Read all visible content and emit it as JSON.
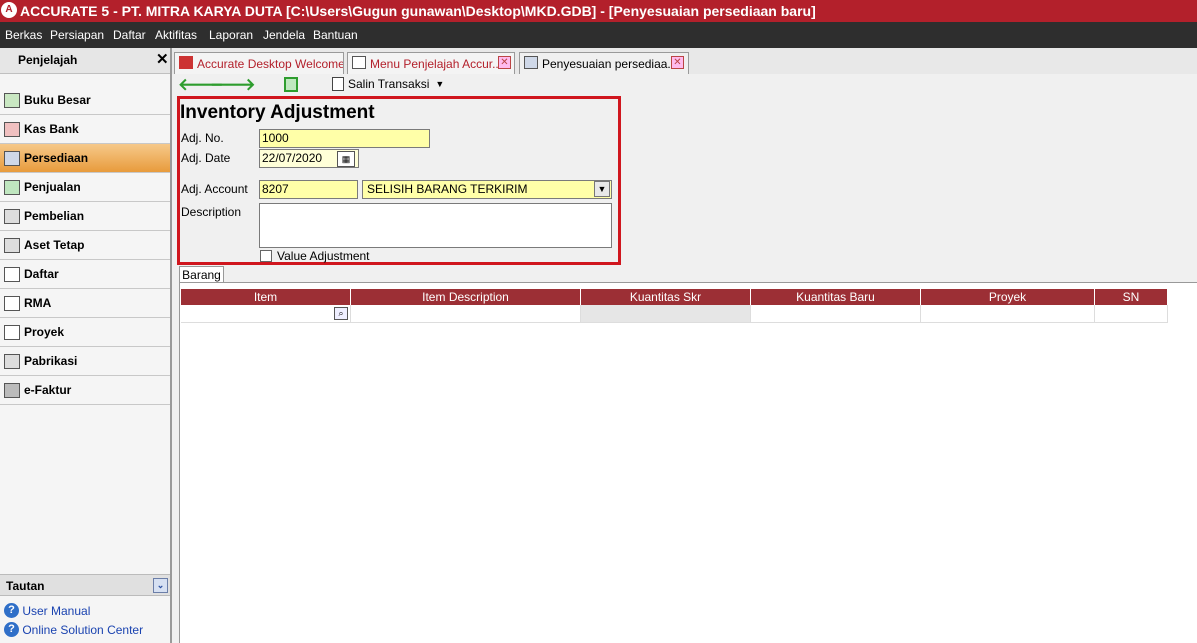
{
  "window": {
    "title": "ACCURATE 5  - PT. MITRA KARYA DUTA   [C:\\Users\\Gugun gunawan\\Desktop\\MKD.GDB] - [Penyesuaian persediaan baru]",
    "accent_color": "#b3202b"
  },
  "menu": [
    "Berkas",
    "Persiapan",
    "Daftar",
    "Aktifitas",
    "Laporan",
    "Jendela",
    "Bantuan"
  ],
  "sidebar": {
    "title": "Penjelajah",
    "close_icon": "close-icon",
    "items": [
      {
        "label": "Buku Besar",
        "icon": "ledger-icon"
      },
      {
        "label": "Kas Bank",
        "icon": "bank-icon"
      },
      {
        "label": "Persediaan",
        "icon": "inventory-icon",
        "active": true
      },
      {
        "label": "Penjualan",
        "icon": "sales-icon"
      },
      {
        "label": "Pembelian",
        "icon": "cart-icon"
      },
      {
        "label": "Aset Tetap",
        "icon": "house-icon"
      },
      {
        "label": "Daftar",
        "icon": "list-icon"
      },
      {
        "label": "RMA",
        "icon": "rma-icon"
      },
      {
        "label": "Proyek",
        "icon": "project-icon"
      },
      {
        "label": "Pabrikasi",
        "icon": "factory-icon"
      },
      {
        "label": "e-Faktur",
        "icon": "efaktur-icon"
      }
    ],
    "tautan": {
      "title": "Tautan",
      "links": [
        "User Manual",
        "Online Solution Center"
      ]
    }
  },
  "tabs": [
    {
      "label": "Accurate Desktop Welcome...",
      "closable": false
    },
    {
      "label": "Menu Penjelajah Accur...",
      "closable": true
    },
    {
      "label": "Penyesuaian persediaa...",
      "closable": true,
      "active": true
    }
  ],
  "toolbar": {
    "copy_label": "Salin Transaksi"
  },
  "form": {
    "title": "Inventory Adjustment",
    "adj_no_label": "Adj. No.",
    "adj_no_value": "1000",
    "adj_date_label": "Adj. Date",
    "adj_date_value": "22/07/2020",
    "adj_account_label": "Adj. Account",
    "adj_account_code": "8207",
    "adj_account_name": "SELISIH BARANG TERKIRIM",
    "description_label": "Description",
    "description_value": "",
    "value_adjustment_label": "Value Adjustment",
    "value_adjustment_checked": false
  },
  "grid": {
    "tab_label": "Barang",
    "columns": [
      "Item",
      "Item Description",
      "Kuantitas Skr",
      "Kuantitas Baru",
      "Proyek",
      "SN"
    ],
    "header_color": "#9c2f35"
  }
}
